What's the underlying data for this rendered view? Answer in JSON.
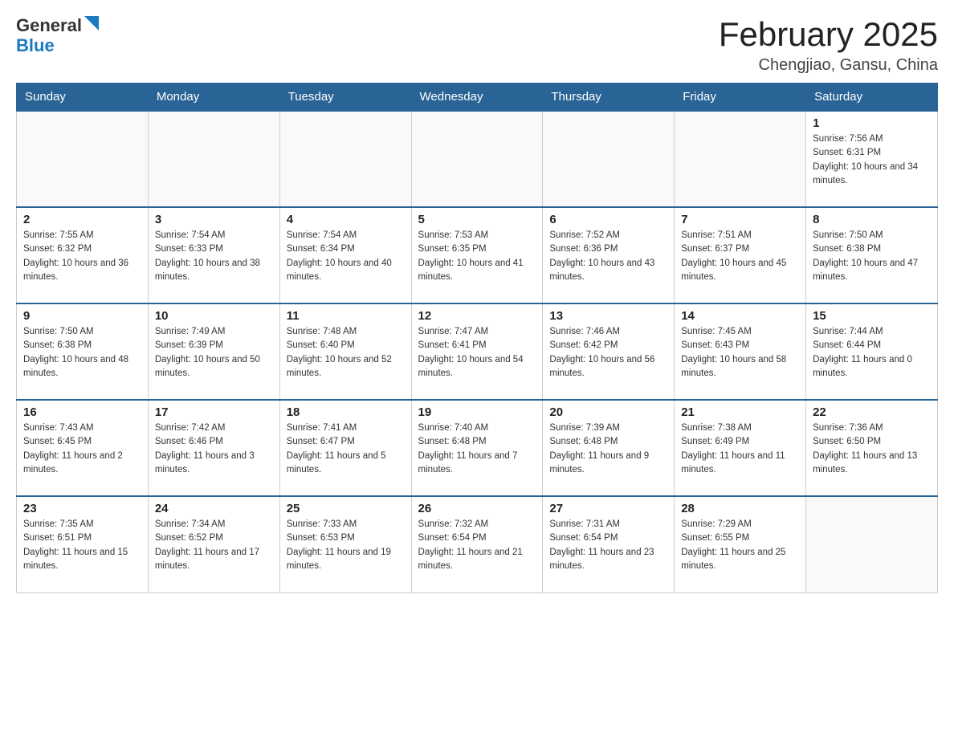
{
  "header": {
    "logo": {
      "text_general": "General",
      "text_blue": "Blue"
    },
    "title": "February 2025",
    "subtitle": "Chengjiao, Gansu, China"
  },
  "weekdays": [
    "Sunday",
    "Monday",
    "Tuesday",
    "Wednesday",
    "Thursday",
    "Friday",
    "Saturday"
  ],
  "weeks": [
    [
      {
        "day": "",
        "info": ""
      },
      {
        "day": "",
        "info": ""
      },
      {
        "day": "",
        "info": ""
      },
      {
        "day": "",
        "info": ""
      },
      {
        "day": "",
        "info": ""
      },
      {
        "day": "",
        "info": ""
      },
      {
        "day": "1",
        "info": "Sunrise: 7:56 AM\nSunset: 6:31 PM\nDaylight: 10 hours and 34 minutes."
      }
    ],
    [
      {
        "day": "2",
        "info": "Sunrise: 7:55 AM\nSunset: 6:32 PM\nDaylight: 10 hours and 36 minutes."
      },
      {
        "day": "3",
        "info": "Sunrise: 7:54 AM\nSunset: 6:33 PM\nDaylight: 10 hours and 38 minutes."
      },
      {
        "day": "4",
        "info": "Sunrise: 7:54 AM\nSunset: 6:34 PM\nDaylight: 10 hours and 40 minutes."
      },
      {
        "day": "5",
        "info": "Sunrise: 7:53 AM\nSunset: 6:35 PM\nDaylight: 10 hours and 41 minutes."
      },
      {
        "day": "6",
        "info": "Sunrise: 7:52 AM\nSunset: 6:36 PM\nDaylight: 10 hours and 43 minutes."
      },
      {
        "day": "7",
        "info": "Sunrise: 7:51 AM\nSunset: 6:37 PM\nDaylight: 10 hours and 45 minutes."
      },
      {
        "day": "8",
        "info": "Sunrise: 7:50 AM\nSunset: 6:38 PM\nDaylight: 10 hours and 47 minutes."
      }
    ],
    [
      {
        "day": "9",
        "info": "Sunrise: 7:50 AM\nSunset: 6:38 PM\nDaylight: 10 hours and 48 minutes."
      },
      {
        "day": "10",
        "info": "Sunrise: 7:49 AM\nSunset: 6:39 PM\nDaylight: 10 hours and 50 minutes."
      },
      {
        "day": "11",
        "info": "Sunrise: 7:48 AM\nSunset: 6:40 PM\nDaylight: 10 hours and 52 minutes."
      },
      {
        "day": "12",
        "info": "Sunrise: 7:47 AM\nSunset: 6:41 PM\nDaylight: 10 hours and 54 minutes."
      },
      {
        "day": "13",
        "info": "Sunrise: 7:46 AM\nSunset: 6:42 PM\nDaylight: 10 hours and 56 minutes."
      },
      {
        "day": "14",
        "info": "Sunrise: 7:45 AM\nSunset: 6:43 PM\nDaylight: 10 hours and 58 minutes."
      },
      {
        "day": "15",
        "info": "Sunrise: 7:44 AM\nSunset: 6:44 PM\nDaylight: 11 hours and 0 minutes."
      }
    ],
    [
      {
        "day": "16",
        "info": "Sunrise: 7:43 AM\nSunset: 6:45 PM\nDaylight: 11 hours and 2 minutes."
      },
      {
        "day": "17",
        "info": "Sunrise: 7:42 AM\nSunset: 6:46 PM\nDaylight: 11 hours and 3 minutes."
      },
      {
        "day": "18",
        "info": "Sunrise: 7:41 AM\nSunset: 6:47 PM\nDaylight: 11 hours and 5 minutes."
      },
      {
        "day": "19",
        "info": "Sunrise: 7:40 AM\nSunset: 6:48 PM\nDaylight: 11 hours and 7 minutes."
      },
      {
        "day": "20",
        "info": "Sunrise: 7:39 AM\nSunset: 6:48 PM\nDaylight: 11 hours and 9 minutes."
      },
      {
        "day": "21",
        "info": "Sunrise: 7:38 AM\nSunset: 6:49 PM\nDaylight: 11 hours and 11 minutes."
      },
      {
        "day": "22",
        "info": "Sunrise: 7:36 AM\nSunset: 6:50 PM\nDaylight: 11 hours and 13 minutes."
      }
    ],
    [
      {
        "day": "23",
        "info": "Sunrise: 7:35 AM\nSunset: 6:51 PM\nDaylight: 11 hours and 15 minutes."
      },
      {
        "day": "24",
        "info": "Sunrise: 7:34 AM\nSunset: 6:52 PM\nDaylight: 11 hours and 17 minutes."
      },
      {
        "day": "25",
        "info": "Sunrise: 7:33 AM\nSunset: 6:53 PM\nDaylight: 11 hours and 19 minutes."
      },
      {
        "day": "26",
        "info": "Sunrise: 7:32 AM\nSunset: 6:54 PM\nDaylight: 11 hours and 21 minutes."
      },
      {
        "day": "27",
        "info": "Sunrise: 7:31 AM\nSunset: 6:54 PM\nDaylight: 11 hours and 23 minutes."
      },
      {
        "day": "28",
        "info": "Sunrise: 7:29 AM\nSunset: 6:55 PM\nDaylight: 11 hours and 25 minutes."
      },
      {
        "day": "",
        "info": ""
      }
    ]
  ]
}
